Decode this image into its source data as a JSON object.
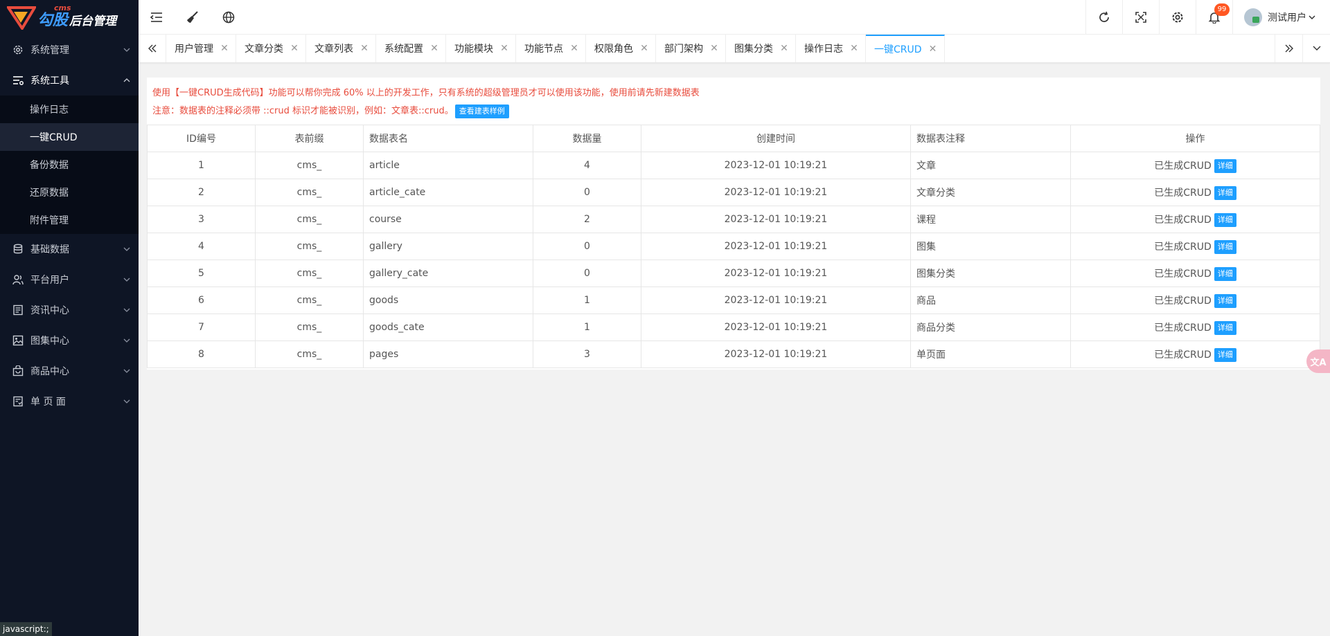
{
  "brand": {
    "cms": "cms",
    "name": "勾股",
    "sub": "后台管理"
  },
  "sidebar": {
    "items": [
      {
        "label": "系统管理",
        "icon": "gear-icon"
      },
      {
        "label": "系统工具",
        "icon": "tools-icon",
        "open": true
      },
      {
        "label": "基础数据",
        "icon": "database-icon"
      },
      {
        "label": "平台用户",
        "icon": "users-icon"
      },
      {
        "label": "资讯中心",
        "icon": "news-icon"
      },
      {
        "label": "图集中心",
        "icon": "image-icon"
      },
      {
        "label": "商品中心",
        "icon": "bag-icon"
      },
      {
        "label": "单 页 面",
        "icon": "page-icon"
      }
    ],
    "subitems": [
      {
        "label": "操作日志"
      },
      {
        "label": "一键CRUD",
        "active": true
      },
      {
        "label": "备份数据"
      },
      {
        "label": "还原数据"
      },
      {
        "label": "附件管理"
      }
    ]
  },
  "header": {
    "notifications": "99",
    "user": "测试用户"
  },
  "tabs": [
    "用户管理",
    "文章分类",
    "文章列表",
    "系统配置",
    "功能模块",
    "功能节点",
    "权限角色",
    "部门架构",
    "图集分类",
    "操作日志",
    "一键CRUD"
  ],
  "active_tab": "一键CRUD",
  "notice": {
    "line1": "使用【一键CRUD生成代码】功能可以帮你完成 60% 以上的开发工作，只有系统的超级管理员才可以使用该功能，使用前请先新建数据表",
    "line2": "注意：数据表的注释必须带 ::crud 标识才能被识别，例如：文章表::crud。",
    "sample_btn": "查看建表样例"
  },
  "table": {
    "headers": [
      "ID编号",
      "表前缀",
      "数据表名",
      "数据量",
      "创建时间",
      "数据表注释",
      "操作"
    ],
    "rows": [
      {
        "id": "1",
        "prefix": "cms_",
        "name": "article",
        "count": "4",
        "created": "2023-12-01 10:19:21",
        "comment": "文章",
        "status": "已生成CRUD",
        "btn": "详细"
      },
      {
        "id": "2",
        "prefix": "cms_",
        "name": "article_cate",
        "count": "0",
        "created": "2023-12-01 10:19:21",
        "comment": "文章分类",
        "status": "已生成CRUD",
        "btn": "详细"
      },
      {
        "id": "3",
        "prefix": "cms_",
        "name": "course",
        "count": "2",
        "created": "2023-12-01 10:19:21",
        "comment": "课程",
        "status": "已生成CRUD",
        "btn": "详细"
      },
      {
        "id": "4",
        "prefix": "cms_",
        "name": "gallery",
        "count": "0",
        "created": "2023-12-01 10:19:21",
        "comment": "图集",
        "status": "已生成CRUD",
        "btn": "详细"
      },
      {
        "id": "5",
        "prefix": "cms_",
        "name": "gallery_cate",
        "count": "0",
        "created": "2023-12-01 10:19:21",
        "comment": "图集分类",
        "status": "已生成CRUD",
        "btn": "详细"
      },
      {
        "id": "6",
        "prefix": "cms_",
        "name": "goods",
        "count": "1",
        "created": "2023-12-01 10:19:21",
        "comment": "商品",
        "status": "已生成CRUD",
        "btn": "详细"
      },
      {
        "id": "7",
        "prefix": "cms_",
        "name": "goods_cate",
        "count": "1",
        "created": "2023-12-01 10:19:21",
        "comment": "商品分类",
        "status": "已生成CRUD",
        "btn": "详细"
      },
      {
        "id": "8",
        "prefix": "cms_",
        "name": "pages",
        "count": "3",
        "created": "2023-12-01 10:19:21",
        "comment": "单页面",
        "status": "已生成CRUD",
        "btn": "详细"
      }
    ]
  },
  "status_tip": "javascript:;",
  "float_tool": "文A"
}
